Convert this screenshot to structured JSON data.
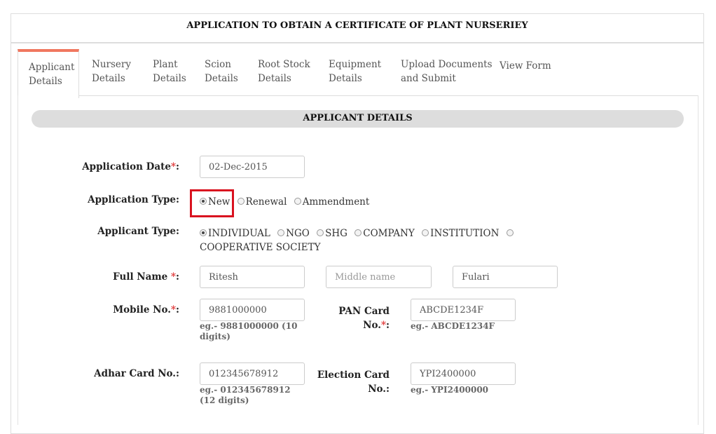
{
  "form_title": "APPLICATION TO OBTAIN A CERTIFICATE OF PLANT NURSERIEY",
  "tabs": [
    {
      "line1": "Applicant",
      "line2": "Details"
    },
    {
      "line1": "Nursery",
      "line2": "Details"
    },
    {
      "line1": "Plant",
      "line2": "Details"
    },
    {
      "line1": "Scion",
      "line2": "Details"
    },
    {
      "line1": "Root Stock",
      "line2": "Details"
    },
    {
      "line1": "Equipment",
      "line2": "Details"
    },
    {
      "line1": "Upload Documents",
      "line2": "and Submit"
    },
    {
      "line1": "View Form",
      "line2": ""
    }
  ],
  "active_tab": "Applicant Details",
  "section_title": "APPLICANT DETAILS",
  "required_mark": "*",
  "colon": ":",
  "application_date": {
    "label": "Application Date",
    "value": "02-Dec-2015"
  },
  "application_type": {
    "label": "Application Type:",
    "options": [
      "New",
      "Renewal",
      "Ammendment"
    ],
    "selected": "New"
  },
  "applicant_type": {
    "label": "Applicant Type:",
    "options": [
      "INDIVIDUAL",
      "NGO",
      "SHG",
      "COMPANY",
      "INSTITUTION",
      "COOPERATIVE SOCIETY"
    ],
    "selected": "INDIVIDUAL"
  },
  "full_name": {
    "label": "Full Name ",
    "first": "Ritesh",
    "middle_placeholder": "Middle name",
    "middle": "",
    "last": "Fulari"
  },
  "mobile": {
    "label": "Mobile No.",
    "value": "9881000000",
    "hint": "eg.- 9881000000 (10 digits)"
  },
  "pan": {
    "label_line1": "PAN Card",
    "label_line2": "No.",
    "value": "ABCDE1234F",
    "hint": "eg.- ABCDE1234F"
  },
  "adhar": {
    "label": "Adhar Card No.:",
    "value": "012345678912",
    "hint": "eg.- 012345678912 (12 digits)"
  },
  "election": {
    "label_line1": "Election Card",
    "label_line2": "No.:",
    "value": "YPI2400000",
    "hint": "eg.- YPI2400000"
  },
  "colors": {
    "accent": "#f0775f",
    "highlight": "#d9121f",
    "required": "#e03a3a"
  }
}
